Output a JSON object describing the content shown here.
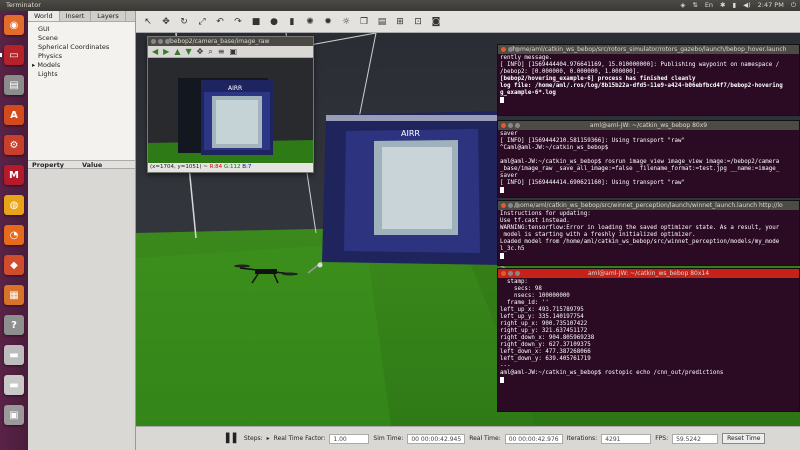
{
  "topbar": {
    "title": "Terminator",
    "time": "2:47 PM"
  },
  "launcher": {
    "icons": [
      {
        "name": "dash-icon",
        "color": "#e36b2c",
        "glyph": "◉"
      },
      {
        "name": "terminal-icon",
        "color": "#b5222a",
        "glyph": "▭"
      },
      {
        "name": "files-icon",
        "color": "#8c8c8c",
        "glyph": "▤"
      },
      {
        "name": "text-editor-icon",
        "color": "#d24a1d",
        "glyph": "A"
      },
      {
        "name": "settings-icon",
        "color": "#c8402b",
        "glyph": "⚙"
      },
      {
        "name": "mendeley-icon",
        "color": "#b31b2a",
        "glyph": "M"
      },
      {
        "name": "chrome-icon",
        "color": "#e8a318",
        "glyph": "◍"
      },
      {
        "name": "firefox-icon",
        "color": "#e66a1c",
        "glyph": "◔"
      },
      {
        "name": "software-center-icon",
        "color": "#cf4c2c",
        "glyph": "◆"
      },
      {
        "name": "package-icon",
        "color": "#d8732a",
        "glyph": "▦"
      },
      {
        "name": "help-icon",
        "color": "#8f8f8f",
        "glyph": "?"
      },
      {
        "name": "drive-icon",
        "color": "#bdbdbd",
        "glyph": "▬"
      },
      {
        "name": "drive2-icon",
        "color": "#c9c9c9",
        "glyph": "▬"
      },
      {
        "name": "trash-icon",
        "color": "#9a9a9a",
        "glyph": "▣"
      }
    ]
  },
  "gazebo": {
    "tabs": [
      "World",
      "Insert",
      "Layers"
    ],
    "tree": [
      "GUI",
      "Scene",
      "Spherical Coordinates",
      "Physics",
      "Models",
      "Lights"
    ],
    "prop_cols": [
      "Property",
      "Value"
    ],
    "bottom": {
      "steps_label": "Steps:",
      "rtf_label": "Real Time Factor:",
      "rtf": "1.00",
      "sim_label": "Sim Time:",
      "sim": "00 00:00:42.945",
      "real_label": "Real Time:",
      "real": "00 00:00:42.976",
      "iter_label": "Iterations:",
      "iter": "4291",
      "fps_label": "FPS:",
      "fps": "59.5242",
      "reset": "Reset Time"
    }
  },
  "image_view": {
    "title": "/bebop2/camera_base/image_raw",
    "status_pos": "(x=1704, y=1051) ~",
    "status_r": "R:84",
    "status_g": "G:112",
    "status_b": "B:7",
    "gate_text": "AIRR"
  },
  "scene": {
    "gate_text": "AIRR"
  },
  "terminals": [
    {
      "title": "/home/aml/catkin_ws_bebop/src/rotors_simulator/rotors_gazebo/launch/bebop_hover.launch",
      "lines": [
        "rently message.",
        "[ INFO] [1569444404.976641169, 15.010000000]: Publishing waypoint on namespace /",
        "/bebop2: [0.000000, 0.000000, 1.000000].",
        "[bebop2/hovering_example-6] process has finished cleanly",
        "log file: /home/aml/.ros/log/8b15b22a-dfd5-11e9-a424-b06ebfbcd4f7/bebop2-hovering",
        "g_example-6*.log"
      ]
    },
    {
      "title": "aml@aml-JW: ~/catkin_ws_bebop 80x9",
      "lines": [
        "saver",
        "[ INFO] [1569444210.581159366]: Using transport \"raw\"",
        "^Caml@aml-JW:~/catkin_ws_bebop$",
        "",
        "aml@aml-JW:~/catkin_ws_bebop$ rosrun image_view image_view image:=/bebop2/camera",
        "_base/image_raw _save_all_image:=false _filename_format:=test.jpg __name:=image_",
        "saver",
        "[ INFO] [1569444414.690621160]: Using transport \"raw\""
      ]
    },
    {
      "title": "/home/aml/catkin_ws_bebop/src/winnet_perception/launch/winnet_launch.launch http://lo",
      "lines": [
        "Instructions for updating:",
        "Use tf.cast instead.",
        "WARNING:tensorflow:Error in loading the saved optimizer state. As a result, your",
        " model is starting with a freshly initialized optimizer.",
        "Loaded model from /home/aml/catkin_ws_bebop/src/winnet_perception/models/my_mode",
        "l_3c.h5"
      ]
    },
    {
      "title": "aml@aml-JW: ~/catkin_ws_bebop 80x14",
      "lines": [
        "  stamp:",
        "    secs: 98",
        "    nsecs: 100000000",
        "  frame_id: ''",
        "left_up_x: 493.715789795",
        "left_up_y: 335.140197754",
        "right_up_x: 900.735107422",
        "right_up_y: 321.637451172",
        "right_down_x: 904.805969238",
        "right_down_y: 627.37109375",
        "left_down_x: 477.387268066",
        "left_down_y: 639.405761719",
        "---",
        "aml@aml-JW:~/catkin_ws_bebop$ rostopic echo /cnn_out/predictions"
      ]
    }
  ]
}
